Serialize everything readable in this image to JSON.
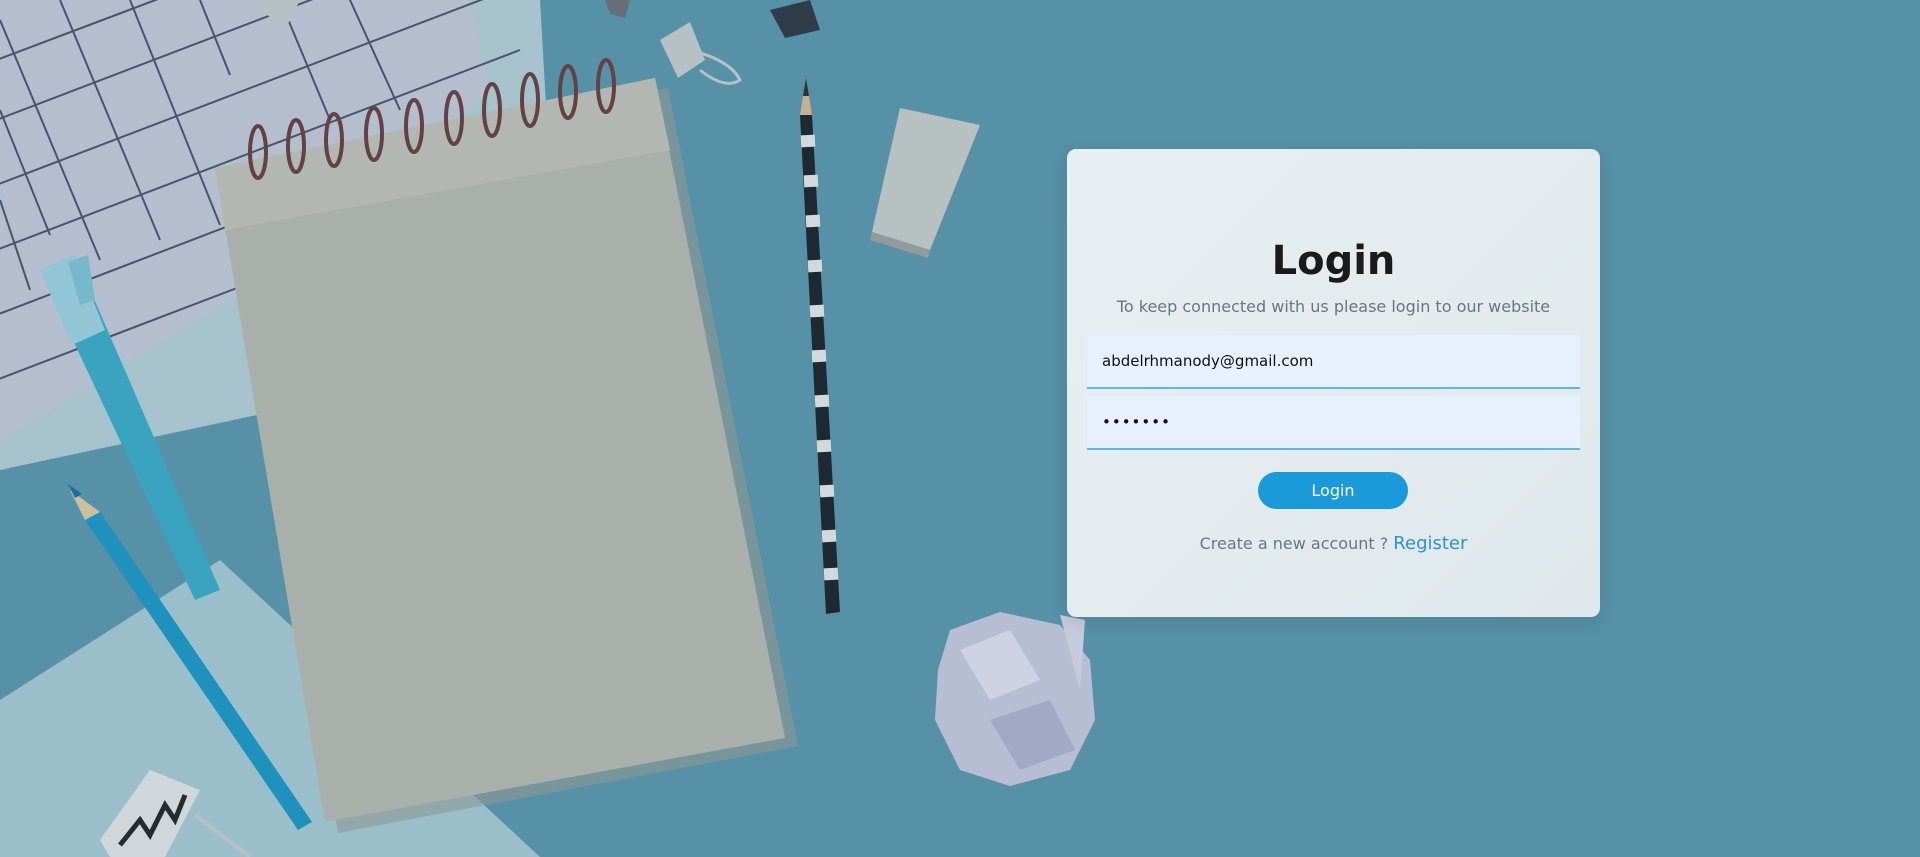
{
  "login": {
    "title": "Login",
    "subtitle": "To keep connected with us please login to our website",
    "email_value": "abdelrhmanody@gmail.com",
    "password_value": "•••••••",
    "button_label": "Login",
    "register_prompt": "Create a new account ? ",
    "register_link": "Register"
  },
  "colors": {
    "background": "#5a95ab",
    "accent": "#1a9ad8",
    "link": "#2d93cc",
    "card": "#e5edf0",
    "input_bg": "#e8f0fe"
  },
  "icons": [
    "notebook-icon",
    "pencil-icon",
    "eraser-icon",
    "binder-clip-icon",
    "crumpled-paper-icon",
    "marker-pen-icon"
  ]
}
